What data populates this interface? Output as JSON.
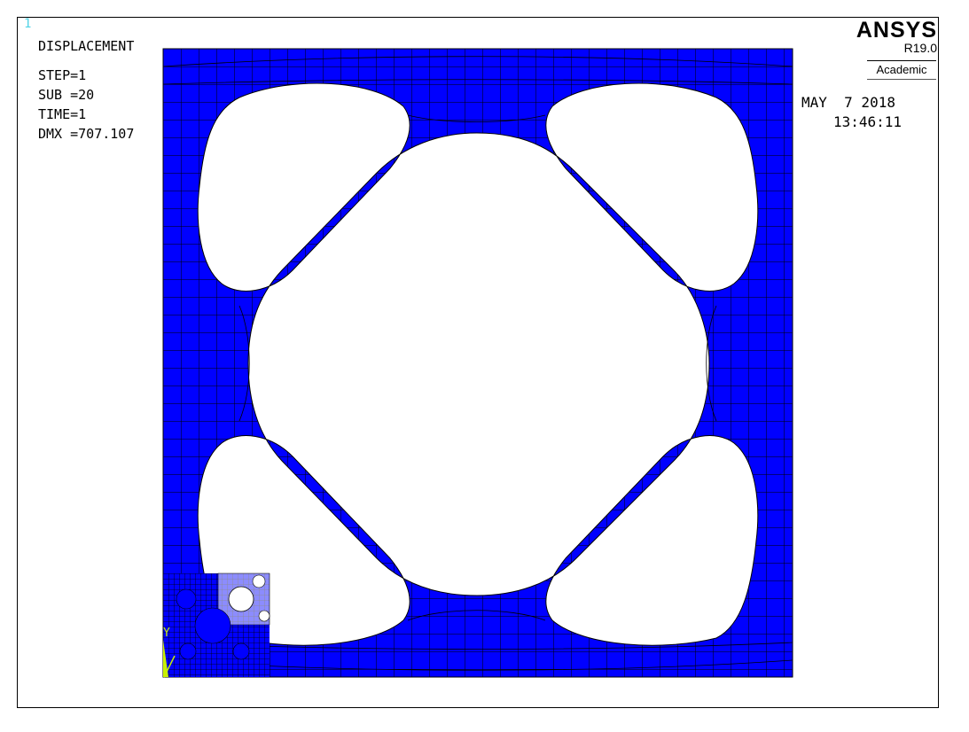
{
  "window_number": "1",
  "result_label": "DISPLACEMENT",
  "step": "STEP=1",
  "substep": "SUB =20",
  "time": "TIME=1",
  "dmx": "DMX =707.107",
  "brand": {
    "name": "ANSYS",
    "release": "R19.0",
    "edition": "Academic"
  },
  "date": "MAY  7 2018",
  "clock": "13:46:11",
  "triad": {
    "y_label": "Y"
  },
  "colors": {
    "mesh_fill": "#0000ff",
    "mesh_lines": "#000000",
    "background": "#ffffff",
    "triad": "#c8f000",
    "window_number": "#4fd3e6"
  }
}
